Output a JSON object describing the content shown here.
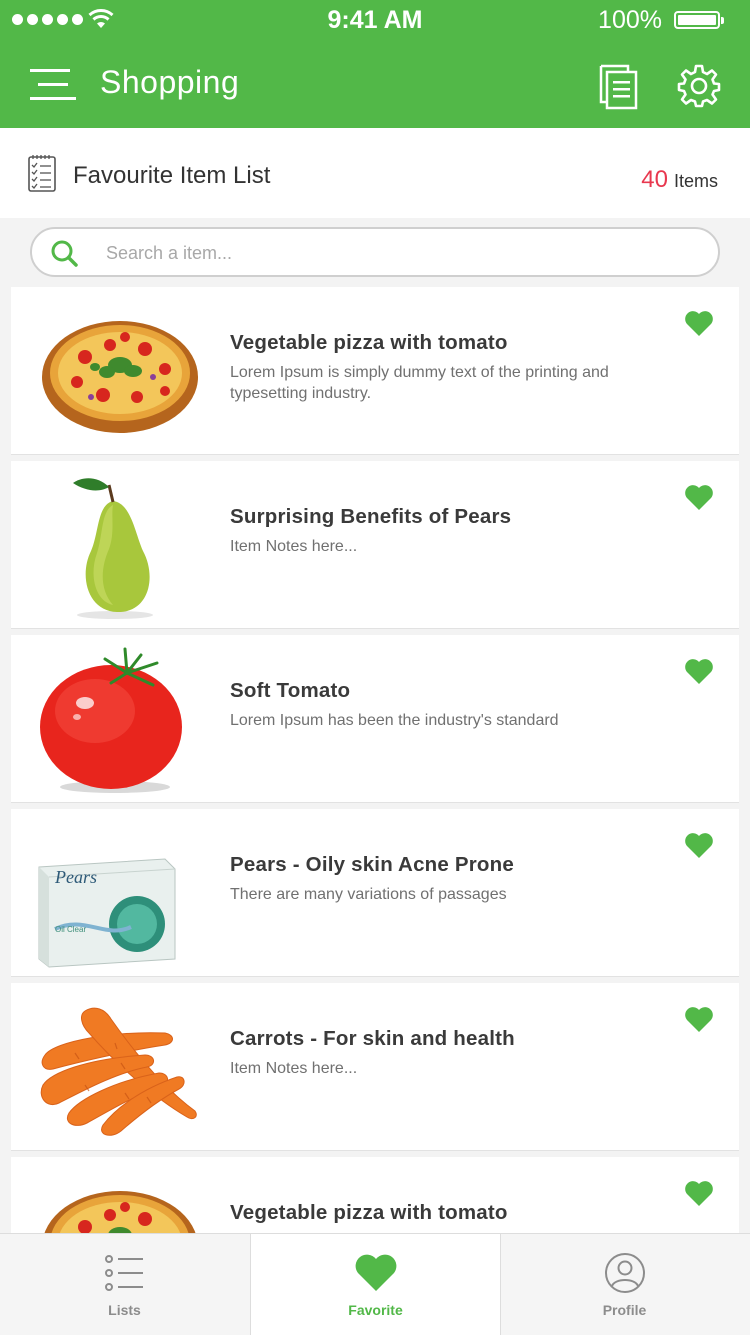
{
  "status_bar": {
    "time": "9:41 AM",
    "battery": "100%"
  },
  "header": {
    "title": "Shopping",
    "icons": [
      "menu-icon",
      "document-list-icon",
      "gear-icon"
    ],
    "color": "#52b848"
  },
  "subheader": {
    "title": "Favourite Item List",
    "count": "40",
    "count_label": "Items",
    "count_color": "#e8384f"
  },
  "search": {
    "placeholder": "Search a item..."
  },
  "items": [
    {
      "title": "Vegetable pizza with tomato",
      "desc": "Lorem Ipsum is simply dummy text of the printing and typesetting industry.",
      "image": "pizza"
    },
    {
      "title": "Surprising Benefits of Pears",
      "desc": "Item Notes here...",
      "image": "pear"
    },
    {
      "title": "Soft Tomato",
      "desc": "Lorem Ipsum has been the industry's standard",
      "image": "tomato"
    },
    {
      "title": "Pears - Oily skin Acne Prone",
      "desc": "There are many variations of passages",
      "image": "soap",
      "brand": "Pears",
      "brand_sub": "Oil Clear"
    },
    {
      "title": "Carrots - For skin and health",
      "desc": "Item Notes here...",
      "image": "carrots"
    },
    {
      "title": "Vegetable pizza with tomato",
      "desc": "",
      "image": "pizza"
    }
  ],
  "tabs": [
    {
      "label": "Lists",
      "icon": "list-icon"
    },
    {
      "label": "Favorite",
      "icon": "heart-icon",
      "active": true
    },
    {
      "label": "Profile",
      "icon": "profile-icon"
    }
  ]
}
